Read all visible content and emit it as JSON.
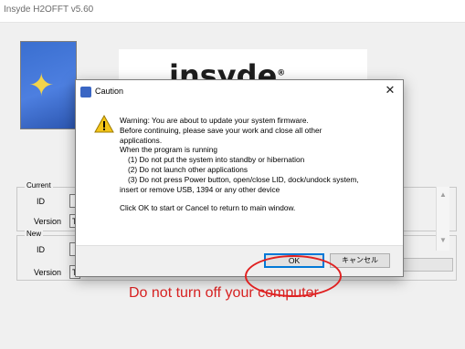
{
  "window": {
    "title": "Insyde H2OFFT v5.60"
  },
  "banner": {
    "brand": "insyde",
    "trademark": "®"
  },
  "current_group": {
    "legend": "Current",
    "id_label": "ID",
    "id_value": "",
    "version_label": "Version",
    "version_value": "T"
  },
  "new_group": {
    "legend": "New",
    "id_label": "ID",
    "id_value": "",
    "version_label": "Version",
    "version_value": "T"
  },
  "warning_banner": "Do not turn off your computer",
  "dialog": {
    "title": "Caution",
    "close_glyph": "✕",
    "lines": [
      "Warning: You are about to update your system firmware.",
      "Before continuing, please save your work and close all other",
      "applications.",
      "When the program is running",
      "(1) Do not put the system into standby or hibernation",
      "(2) Do not launch other applications",
      "(3) Do not press Power button, open/close LID, dock/undock system,",
      "insert or remove USB, 1394 or any other device",
      "Click OK to start or Cancel to return to main window."
    ],
    "ok_label": "OK",
    "cancel_label": "キャンセル"
  },
  "colors": {
    "warning_text": "#d92323",
    "annotation_circle": "#e02020",
    "ok_focus": "#0078d7"
  },
  "icons": {
    "dialog": "app-icon",
    "warning": "warning-icon",
    "close": "close-icon"
  }
}
